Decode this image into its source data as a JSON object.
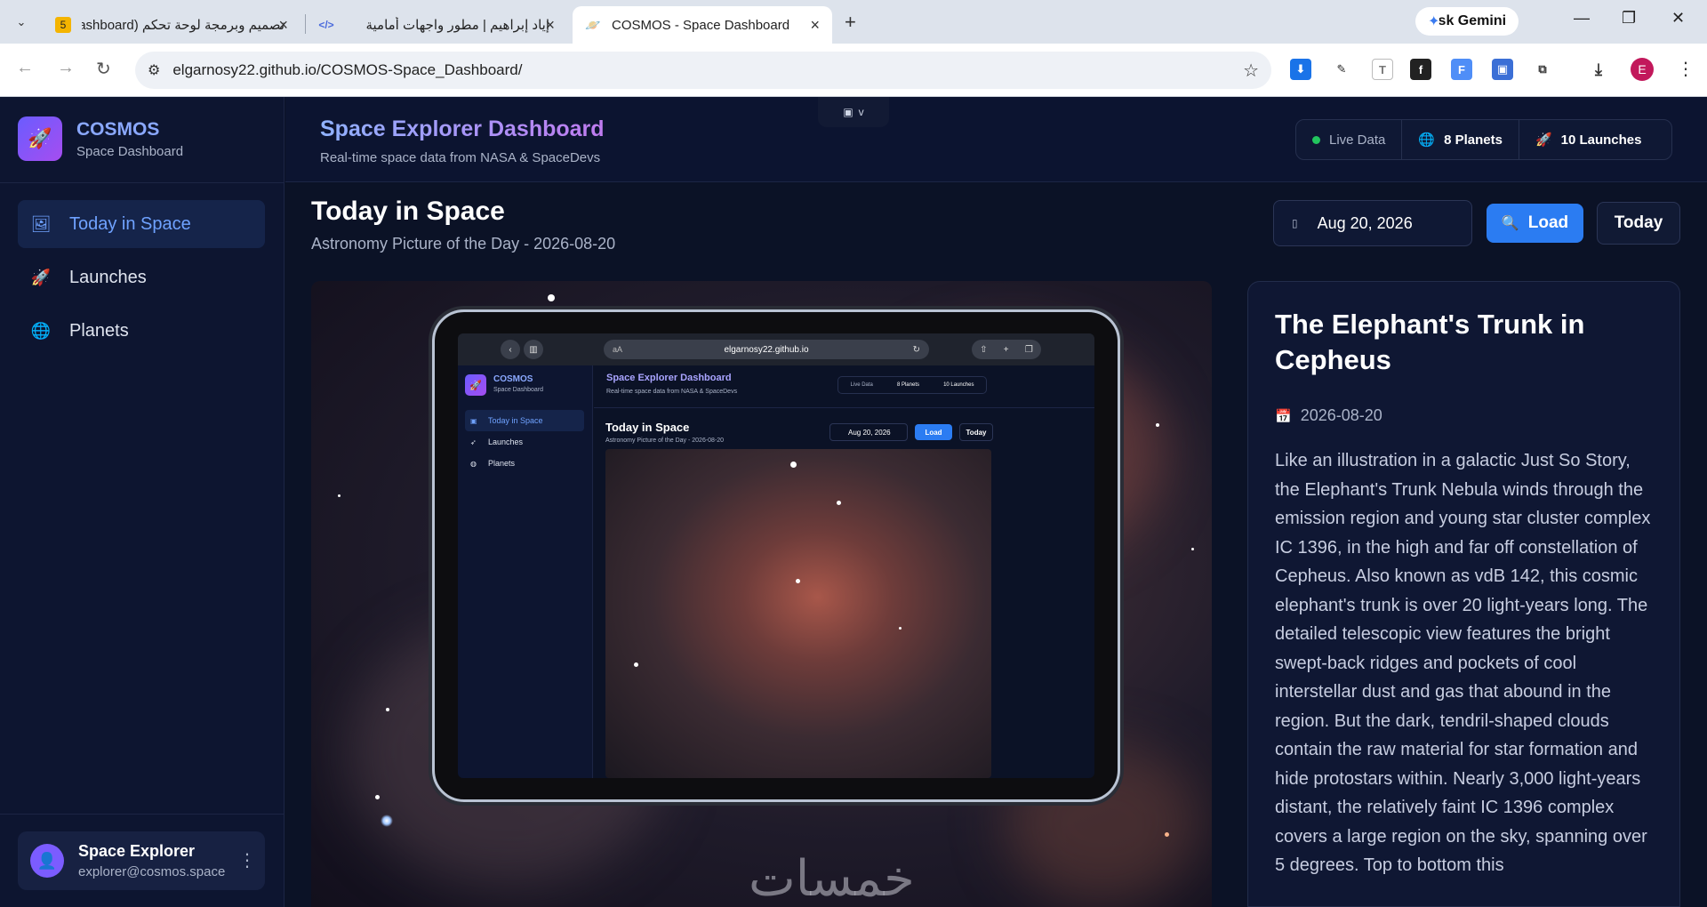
{
  "browser": {
    "tabs": [
      {
        "label": "تصميم وبرمجة لوحة تحكم (Dashboard",
        "badge": "5"
      },
      {
        "label": "إياد إبراهيم | مطور واجهات أمامية"
      },
      {
        "label": "COSMOS - Space Dashboard"
      }
    ],
    "ask_gemini": "Ask Gemini",
    "url": "elgarnosy22.github.io/COSMOS-Space_Dashboard/",
    "profile_initial": "E"
  },
  "app": {
    "brand": {
      "name": "COSMOS",
      "subtitle": "Space Dashboard"
    },
    "nav": [
      {
        "label": "Today in Space",
        "icon": "image-icon",
        "active": true
      },
      {
        "label": "Launches",
        "icon": "rocket-icon"
      },
      {
        "label": "Planets",
        "icon": "globe-icon"
      }
    ],
    "user": {
      "name": "Space Explorer",
      "email": "explorer@cosmos.space"
    },
    "header": {
      "title": "Space Explorer Dashboard",
      "subtitle": "Real-time space data from NASA & SpaceDevs",
      "live": "Live Data",
      "planets": "8 Planets",
      "launches": "10 Launches"
    },
    "section": {
      "title": "Today in Space",
      "subtitle": "Astronomy Picture of the Day - 2026-08-20",
      "date_value": "Aug 20, 2026",
      "load_label": "Load",
      "today_label": "Today"
    },
    "apod": {
      "title": "The Elephant's Trunk in Cepheus",
      "date": "2026-08-20",
      "description": "Like an illustration in a galactic Just So Story, the Elephant's Trunk Nebula winds through the emission region and young star cluster complex IC 1396, in the high and far off constellation of Cepheus. Also known as vdB 142, this cosmic elephant's trunk is over 20 light-years long. The detailed telescopic view features the bright swept-back ridges and pockets of cool interstellar dust and gas that abound in the region. But the dark, tendril-shaped clouds contain the raw material for star formation and hide protostars within. Nearly 3,000 light-years distant, the relatively faint IC 1396 complex covers a large region on the sky, spanning over 5 degrees. Top to bottom this",
      "watermark": "خمسات"
    },
    "tablet": {
      "url": "elgarnosy22.github.io",
      "aa": "aA",
      "brand_name": "COSMOS",
      "brand_sub": "Space Dashboard",
      "nav": [
        "Today in Space",
        "Launches",
        "Planets"
      ],
      "title": "Space Explorer Dashboard",
      "subtitle": "Real-time space data from NASA & SpaceDevs",
      "live": "Live Data",
      "planets": "8 Planets",
      "launches": "10 Launches",
      "section_title": "Today in Space",
      "section_sub": "Astronomy Picture of the Day - 2026-08-20",
      "date_value": "Aug 20, 2026",
      "load": "Load",
      "today": "Today"
    }
  }
}
